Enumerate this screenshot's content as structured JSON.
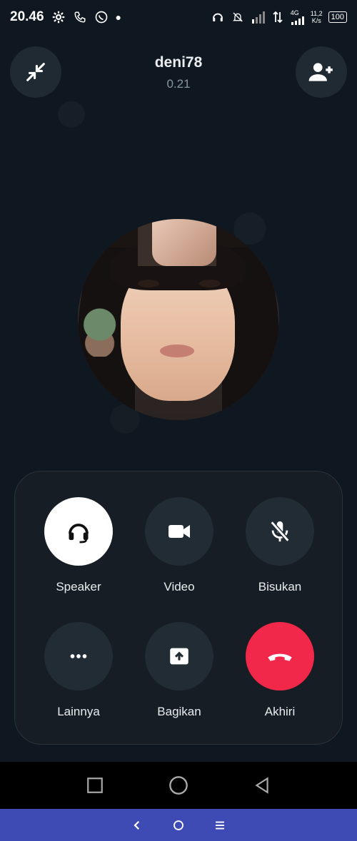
{
  "status_bar": {
    "time": "20.46",
    "signal_label": "4G",
    "speed_value": "11,2",
    "speed_unit": "K/s",
    "battery": "100"
  },
  "call": {
    "caller_name": "deni78",
    "timer": "0.21"
  },
  "controls": [
    {
      "id": "speaker",
      "label": "Speaker",
      "icon": "headset-icon",
      "state": "active"
    },
    {
      "id": "video",
      "label": "Video",
      "icon": "video-camera-icon",
      "state": "normal"
    },
    {
      "id": "mute",
      "label": "Bisukan",
      "icon": "mic-off-icon",
      "state": "normal"
    },
    {
      "id": "more",
      "label": "Lainnya",
      "icon": "more-horizontal-icon",
      "state": "normal"
    },
    {
      "id": "share",
      "label": "Bagikan",
      "icon": "share-upload-icon",
      "state": "normal"
    },
    {
      "id": "end",
      "label": "Akhiri",
      "icon": "end-call-icon",
      "state": "danger"
    }
  ],
  "colors": {
    "background": "#0f1820",
    "panel": "#161d24",
    "button": "#222c34",
    "active_button": "#ffffff",
    "end_call": "#f1284a",
    "bottom_bar": "#3f4bb4"
  }
}
